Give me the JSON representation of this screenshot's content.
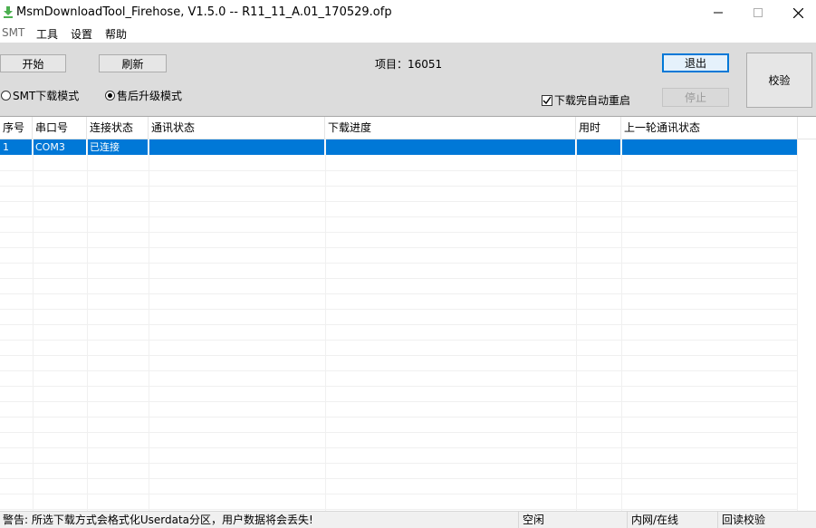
{
  "window": {
    "title": "MsmDownloadTool_Firehose, V1.5.0 -- R11_11_A.01_170529.ofp",
    "icon": "download-arrow-icon"
  },
  "menu": {
    "items": [
      "SMT",
      "工具",
      "设置",
      "帮助"
    ]
  },
  "toolbar": {
    "start_label": "开始",
    "refresh_label": "刷新",
    "project_label": "项目：16051",
    "exit_label": "退出",
    "stop_label": "停止",
    "verify_label": "校验",
    "mode_smt_label": "SMT下载模式",
    "mode_aftersale_label": "售后升级模式",
    "selected_mode": "aftersale",
    "auto_reboot_label": "下载完自动重启",
    "auto_reboot_checked": true
  },
  "table": {
    "columns": [
      "序号",
      "串口号",
      "连接状态",
      "通讯状态",
      "下载进度",
      "用时",
      "上一轮通讯状态"
    ],
    "rows": [
      {
        "index": "1",
        "port": "COM3",
        "connection": "已连接",
        "comm": "",
        "progress": "",
        "time": "",
        "last": ""
      }
    ]
  },
  "status": {
    "warning": "警告: 所选下载方式会格式化Userdata分区，用户数据将会丢失!",
    "state": "空闲",
    "network": "内网/在线",
    "readback": "回读校验"
  },
  "colors": {
    "selection": "#0078d7",
    "toolbar_bg": "#dcdcdc",
    "icon_green": "#4caf50"
  }
}
